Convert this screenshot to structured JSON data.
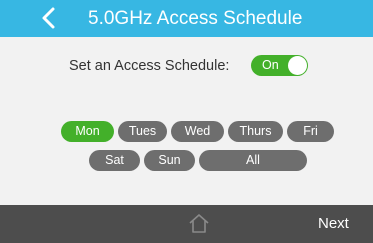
{
  "header": {
    "title": "5.0GHz Access Schedule",
    "back_icon": "chevron-left-icon",
    "background_color": "#37b7e3"
  },
  "schedule": {
    "toggle_label": "Set an Access Schedule:",
    "toggle_state": "On",
    "toggle_on": true,
    "toggle_color": "#43b02a"
  },
  "days": [
    {
      "label": "Mon",
      "selected": true
    },
    {
      "label": "Tues",
      "selected": false
    },
    {
      "label": "Wed",
      "selected": false
    },
    {
      "label": "Thurs",
      "selected": false
    },
    {
      "label": "Fri",
      "selected": false
    },
    {
      "label": "Sat",
      "selected": false
    },
    {
      "label": "Sun",
      "selected": false
    },
    {
      "label": "All",
      "selected": false
    }
  ],
  "day_colors": {
    "selected": "#43b02a",
    "unselected": "#6e6e6e"
  },
  "footer": {
    "home_icon": "home-icon",
    "next_label": "Next",
    "background_color": "#4d4d4d"
  }
}
